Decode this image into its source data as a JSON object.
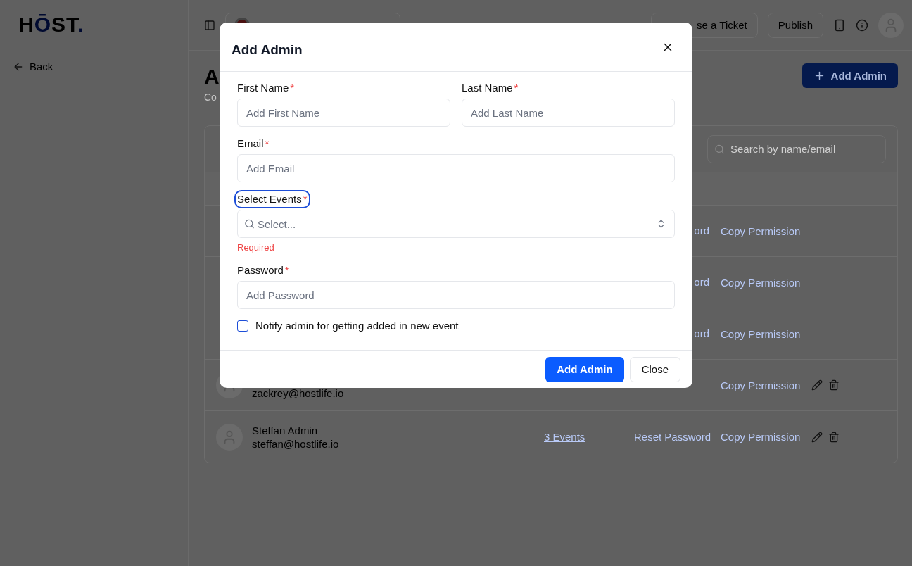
{
  "brand": {
    "logo": [
      {
        "text": "H",
        "accent": false
      },
      {
        "text": "Ō",
        "accent": true
      },
      {
        "text": "ST",
        "accent": false
      },
      {
        "text": ".",
        "accent": true
      }
    ]
  },
  "sidebar": {
    "back": "Back"
  },
  "topbar": {
    "ticket": "se a Ticket",
    "publish": "Publish"
  },
  "page": {
    "title": "A",
    "subtitle": "Co",
    "add_button": "Add Admin"
  },
  "table": {
    "search_placeholder": "Search by name/email",
    "rows": [
      {
        "reset": "ord",
        "copy": "Copy Permission"
      },
      {
        "reset": "ord",
        "copy": "Copy Permission"
      },
      {
        "reset": "ord",
        "copy": "Copy Permission"
      },
      {
        "email": "zackrey@hostlife.io",
        "copy": "Copy Permission"
      },
      {
        "name": "Steffan Admin",
        "email": "steffan@hostlife.io",
        "events": "3 Events",
        "reset": "Reset Password",
        "copy": "Copy Permission"
      }
    ]
  },
  "modal": {
    "title": "Add Admin",
    "rows": [
      {
        "fields": [
          {
            "kind": "text",
            "label": "First Name",
            "required_mark": "*",
            "focused": false,
            "placeholder": "Add First Name"
          },
          {
            "kind": "text",
            "label": "Last Name",
            "required_mark": "*",
            "focused": false,
            "placeholder": "Add Last Name"
          }
        ]
      },
      {
        "fields": [
          {
            "kind": "text",
            "label": "Email",
            "required_mark": "*",
            "focused": false,
            "placeholder": "Add Email"
          }
        ]
      },
      {
        "fields": [
          {
            "kind": "select",
            "label": "Select Events",
            "required_mark": "*",
            "focused": true,
            "placeholder": "Select...",
            "error": "Required"
          }
        ]
      },
      {
        "fields": [
          {
            "kind": "text",
            "label": "Password",
            "required_mark": "*",
            "focused": false,
            "placeholder": "Add Password"
          }
        ]
      }
    ],
    "checkbox": {
      "label": "Notify admin for getting added in new event",
      "checked": false
    },
    "submit": "Add Admin",
    "close": "Close"
  }
}
